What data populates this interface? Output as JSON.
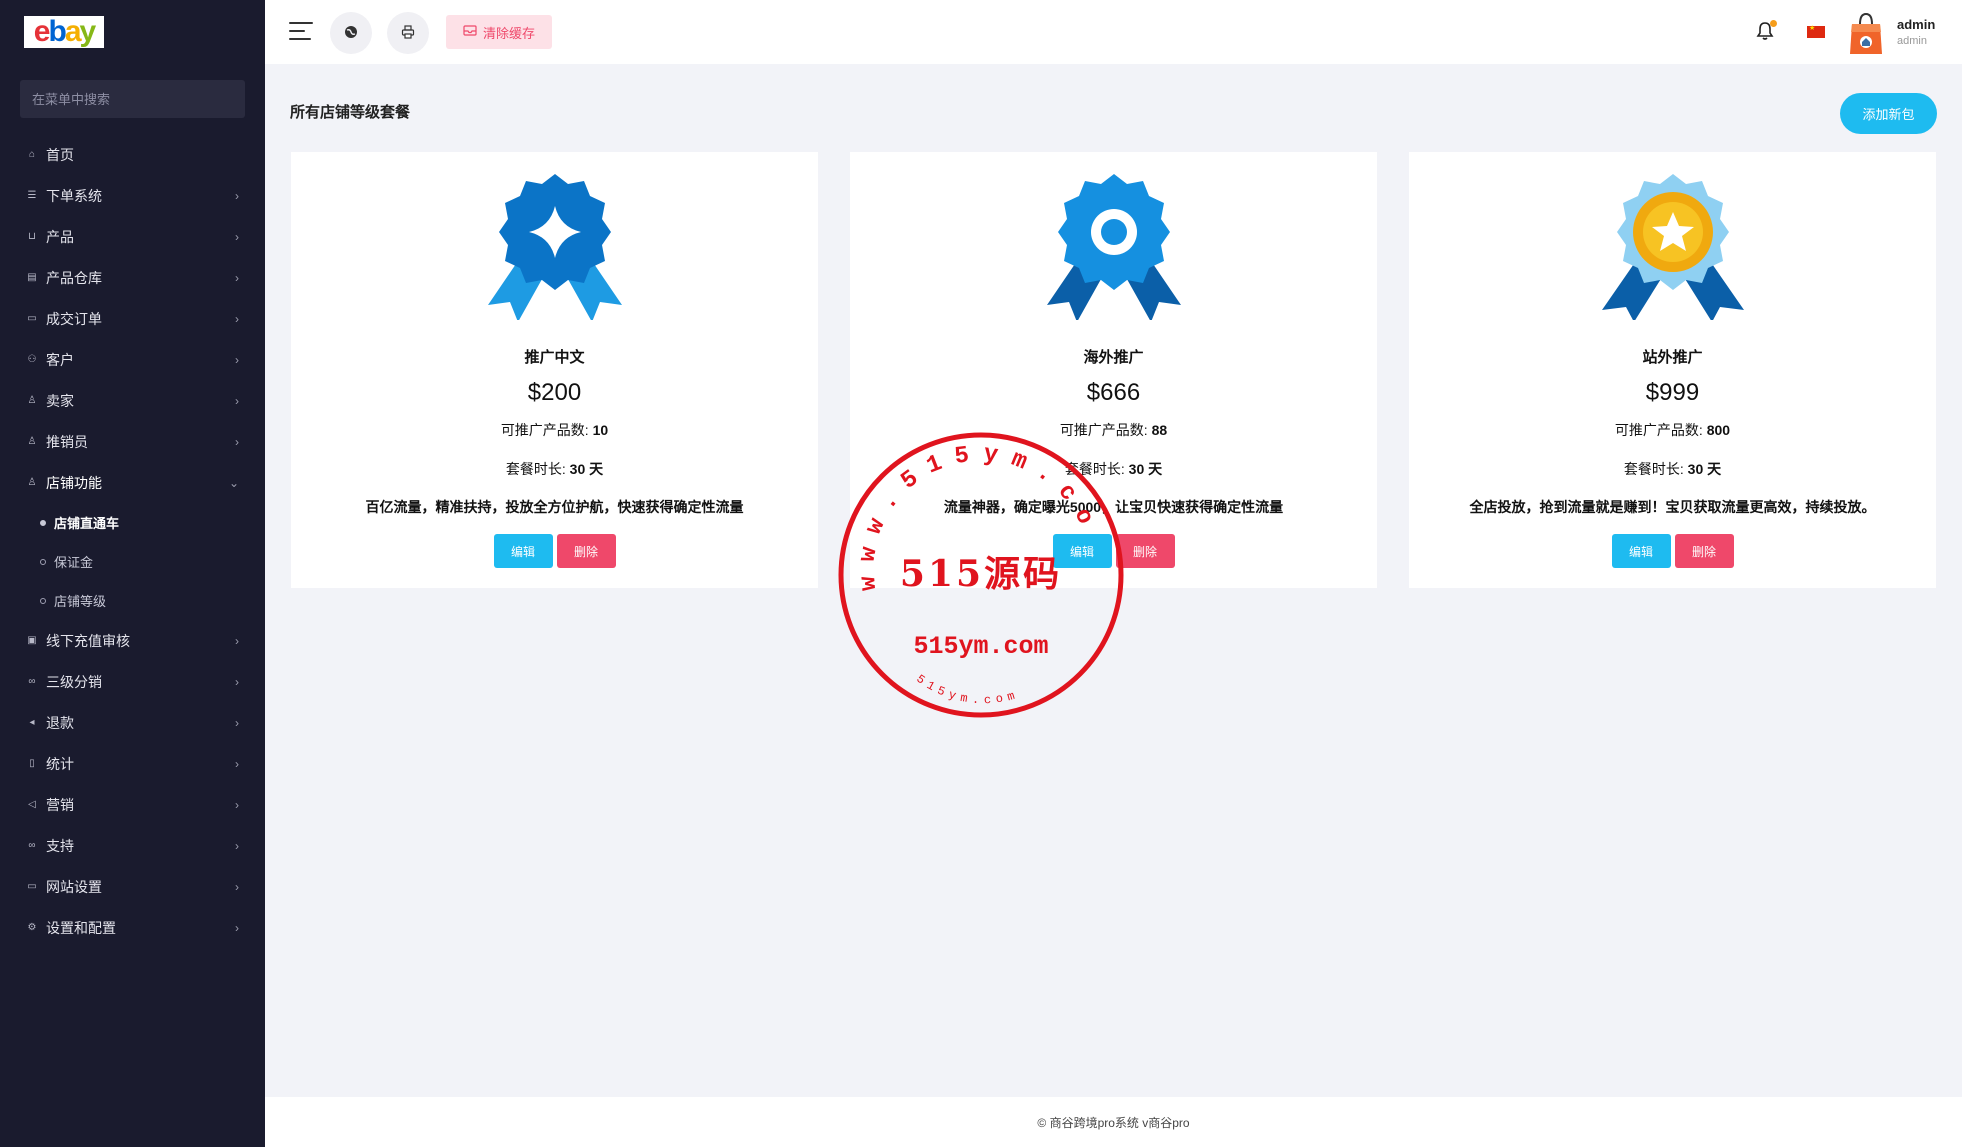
{
  "sidebar": {
    "search_placeholder": "在菜单中搜索",
    "items": [
      {
        "label": "首页",
        "icon": "home-icon",
        "arrow": false
      },
      {
        "label": "下单系统",
        "icon": "list-icon",
        "arrow": true
      },
      {
        "label": "产品",
        "icon": "cart-icon",
        "arrow": true
      },
      {
        "label": "产品仓库",
        "icon": "warehouse-icon",
        "arrow": true
      },
      {
        "label": "成交订单",
        "icon": "order-icon",
        "arrow": true
      },
      {
        "label": "客户",
        "icon": "users-icon",
        "arrow": true
      },
      {
        "label": "卖家",
        "icon": "user-icon",
        "arrow": true
      },
      {
        "label": "推销员",
        "icon": "user-icon",
        "arrow": true
      },
      {
        "label": "店铺功能",
        "icon": "user-icon",
        "arrow": true,
        "open": true
      }
    ],
    "sub_items": [
      {
        "label": "店铺直通车",
        "active": true
      },
      {
        "label": "保证金",
        "active": false
      },
      {
        "label": "店铺等级",
        "active": false
      }
    ],
    "items_after": [
      {
        "label": "线下充值审核",
        "icon": "money-icon"
      },
      {
        "label": "三级分销",
        "icon": "link-icon"
      },
      {
        "label": "退款",
        "icon": "rewind-icon"
      },
      {
        "label": "统计",
        "icon": "doc-icon"
      },
      {
        "label": "营销",
        "icon": "megaphone-icon"
      },
      {
        "label": "支持",
        "icon": "link-icon"
      },
      {
        "label": "网站设置",
        "icon": "monitor-icon"
      },
      {
        "label": "设置和配置",
        "icon": "gear-icon"
      }
    ]
  },
  "header": {
    "clear_cache_label": "清除缓存",
    "user_name": "admin",
    "user_role": "admin"
  },
  "content": {
    "title": "所有店铺等级套餐",
    "add_button": "添加新包",
    "cards": [
      {
        "name": "推广中文",
        "price": "$200",
        "products_label": "可推广产品数:",
        "products_value": "10",
        "duration_label": "套餐时长:",
        "duration_value": "30 天",
        "description": "百亿流量，精准扶持，投放全方位护航，快速获得确定性流量",
        "edit_label": "编辑",
        "delete_label": "删除"
      },
      {
        "name": "海外推广",
        "price": "$666",
        "products_label": "可推广产品数:",
        "products_value": "88",
        "duration_label": "套餐时长:",
        "duration_value": "30 天",
        "description": "流量神器，确定曝光5000，让宝贝快速获得确定性流量",
        "edit_label": "编辑",
        "delete_label": "删除"
      },
      {
        "name": "站外推广",
        "price": "$999",
        "products_label": "可推广产品数:",
        "products_value": "800",
        "duration_label": "套餐时长:",
        "duration_value": "30 天",
        "description": "全店投放，抢到流量就是赚到！宝贝获取流量更高效，持续投放。",
        "edit_label": "编辑",
        "delete_label": "删除"
      }
    ]
  },
  "watermark": {
    "ring_text": "www.515ym.com",
    "center_text": "515源码",
    "url_text": "515ym.com",
    "bottom_text": "515ym.com"
  },
  "footer": {
    "text": "© 商谷跨境pro系统 v商谷pro"
  },
  "colors": {
    "sidebar_bg": "#1a1b2e",
    "accent_blue": "#1ebbf0",
    "danger": "#ef486a",
    "stamp_red": "#e0141e"
  }
}
